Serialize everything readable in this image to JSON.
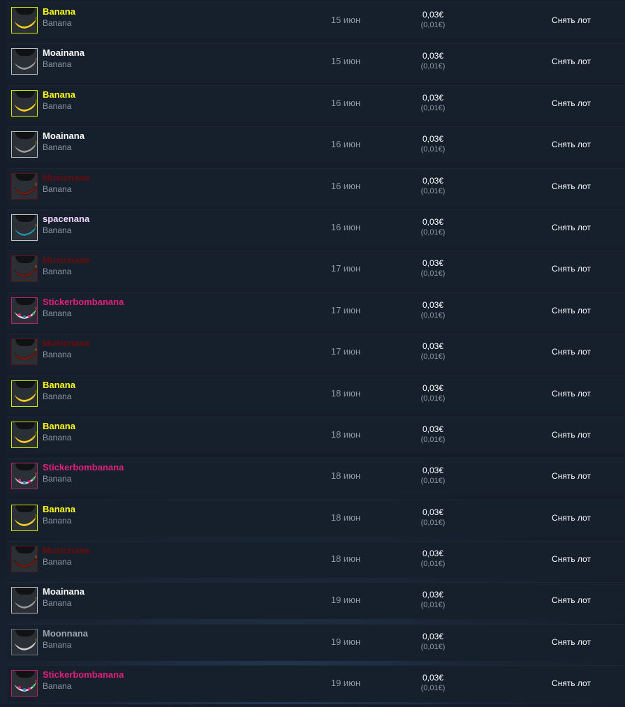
{
  "listings": [
    {
      "name": "Banana",
      "type": "Banana",
      "date": "15 июн",
      "price": "0,03€",
      "price_sub": "(0,01€)",
      "action": "Снять лот",
      "name_color": "#ffff1a",
      "border": "#d2e800",
      "icon": "banana-yellow-icon",
      "fruit": "#f5d22a"
    },
    {
      "name": "Moainana",
      "type": "Banana",
      "date": "15 июн",
      "price": "0,03€",
      "price_sub": "(0,01€)",
      "action": "Снять лот",
      "name_color": "#ffffff",
      "border": "#b8bcc0",
      "icon": "banana-grey-icon",
      "fruit": "#9a9da1"
    },
    {
      "name": "Banana",
      "type": "Banana",
      "date": "16 июн",
      "price": "0,03€",
      "price_sub": "(0,01€)",
      "action": "Снять лот",
      "name_color": "#ffff1a",
      "border": "#d2e800",
      "icon": "banana-yellow-icon",
      "fruit": "#f5d22a"
    },
    {
      "name": "Moainana",
      "type": "Banana",
      "date": "16 июн",
      "price": "0,03€",
      "price_sub": "(0,01€)",
      "action": "Снять лот",
      "name_color": "#ffffff",
      "border": "#b8bcc0",
      "icon": "banana-grey-icon",
      "fruit": "#9a9da1"
    },
    {
      "name": "Musicnana",
      "type": "Banana",
      "date": "16 июн",
      "price": "0,03€",
      "price_sub": "(0,01€)",
      "action": "Снять лот",
      "name_color": "#6a0b0b",
      "border": "#5a1616",
      "icon": "banana-red-icon",
      "fruit": "#7a1a12"
    },
    {
      "name": "spacenana",
      "type": "Banana",
      "date": "16 июн",
      "price": "0,03€",
      "price_sub": "(0,01€)",
      "action": "Снять лот",
      "name_color": "#f4d6ff",
      "border": "#c6c9cc",
      "icon": "banana-teal-icon",
      "fruit": "#2f8fa8"
    },
    {
      "name": "Musicnana",
      "type": "Banana",
      "date": "17 июн",
      "price": "0,03€",
      "price_sub": "(0,01€)",
      "action": "Снять лот",
      "name_color": "#6a0b0b",
      "border": "#5a1616",
      "icon": "banana-red-icon",
      "fruit": "#7a1a12"
    },
    {
      "name": "Stickerbombanana",
      "type": "Banana",
      "date": "17 июн",
      "price": "0,03€",
      "price_sub": "(0,01€)",
      "action": "Снять лот",
      "name_color": "#e0207a",
      "border": "#b8226c",
      "icon": "banana-stickered-icon",
      "fruit": "#d9d9d9"
    },
    {
      "name": "Musicnana",
      "type": "Banana",
      "date": "17 июн",
      "price": "0,03€",
      "price_sub": "(0,01€)",
      "action": "Снять лот",
      "name_color": "#6a0b0b",
      "border": "#5a1616",
      "icon": "banana-red-icon",
      "fruit": "#7a1a12"
    },
    {
      "name": "Banana",
      "type": "Banana",
      "date": "18 июн",
      "price": "0,03€",
      "price_sub": "(0,01€)",
      "action": "Снять лот",
      "name_color": "#ffff1a",
      "border": "#d2e800",
      "icon": "banana-yellow-icon",
      "fruit": "#f5d22a"
    },
    {
      "name": "Banana",
      "type": "Banana",
      "date": "18 июн",
      "price": "0,03€",
      "price_sub": "(0,01€)",
      "action": "Снять лот",
      "name_color": "#ffff1a",
      "border": "#d2e800",
      "icon": "banana-yellow-icon",
      "fruit": "#f5d22a"
    },
    {
      "name": "Stickerbombanana",
      "type": "Banana",
      "date": "18 июн",
      "price": "0,03€",
      "price_sub": "(0,01€)",
      "action": "Снять лот",
      "name_color": "#e0207a",
      "border": "#b8226c",
      "icon": "banana-stickered-icon",
      "fruit": "#d9d9d9"
    },
    {
      "name": "Banana",
      "type": "Banana",
      "date": "18 июн",
      "price": "0,03€",
      "price_sub": "(0,01€)",
      "action": "Снять лот",
      "name_color": "#ffff1a",
      "border": "#d2e800",
      "icon": "banana-yellow-icon",
      "fruit": "#f5d22a"
    },
    {
      "name": "Musicnana",
      "type": "Banana",
      "date": "18 июн",
      "price": "0,03€",
      "price_sub": "(0,01€)",
      "action": "Снять лот",
      "name_color": "#6a0b0b",
      "border": "#5a1616",
      "icon": "banana-red-icon",
      "fruit": "#7a1a12"
    },
    {
      "name": "Moainana",
      "type": "Banana",
      "date": "19 июн",
      "price": "0,03€",
      "price_sub": "(0,01€)",
      "action": "Снять лот",
      "name_color": "#ffffff",
      "border": "#b8bcc0",
      "icon": "banana-grey-icon",
      "fruit": "#9a9da1"
    },
    {
      "name": "Moonnana",
      "type": "Banana",
      "date": "19 июн",
      "price": "0,03€",
      "price_sub": "(0,01€)",
      "action": "Снять лот",
      "name_color": "#9aa6b0",
      "border": "#6b7380",
      "icon": "banana-moon-icon",
      "fruit": "#c9ced3"
    },
    {
      "name": "Stickerbombanana",
      "type": "Banana",
      "date": "19 июн",
      "price": "0,03€",
      "price_sub": "(0,01€)",
      "action": "Снять лот",
      "name_color": "#e0207a",
      "border": "#b8226c",
      "icon": "banana-stickered-icon",
      "fruit": "#d9d9d9"
    }
  ]
}
